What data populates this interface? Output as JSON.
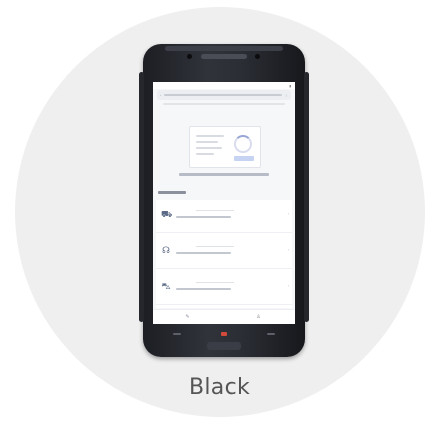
{
  "caption": "Black",
  "colors": {
    "background": "#efefef",
    "device_body": "#2b2e35",
    "value_green": "#34a56a",
    "value_red": "#e0485a",
    "caption_text": "#555555"
  },
  "device": {
    "logo_text": "",
    "screen": {
      "status_time": "",
      "url": "",
      "section_title": "",
      "rows": [
        {
          "icon": "truck-icon",
          "code": "",
          "value": "",
          "value_color": "#34a56a"
        },
        {
          "icon": "headset-icon",
          "code": "",
          "value": "",
          "value_color": "#e0485a"
        },
        {
          "icon": "vehicle-icon",
          "code": "",
          "value": "",
          "value_color": "#34a56a"
        }
      ],
      "nav": {
        "left_label": "",
        "right_label": ""
      }
    }
  }
}
